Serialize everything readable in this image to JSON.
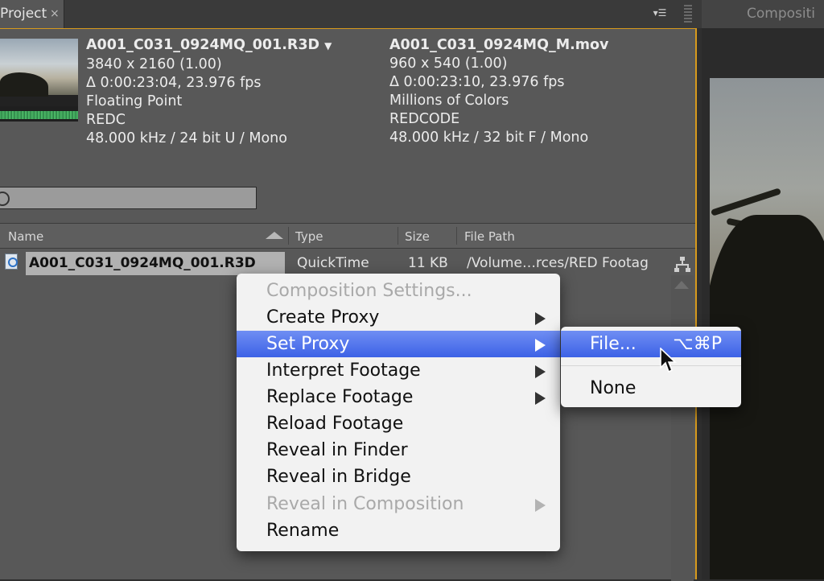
{
  "tabs": {
    "project": "Project",
    "close": "×",
    "composition": "Compositi"
  },
  "panel_menu_icon": "▾☰",
  "footage_info": {
    "source": {
      "name": "A001_C031_0924MQ_001.R3D",
      "caret": "▼",
      "resolution": "3840 x 2160 (1.00)",
      "duration": "Δ 0:00:23:04, 23.976 fps",
      "depth": "Floating Point",
      "codec": "REDC",
      "audio": "48.000 kHz / 24 bit U / Mono"
    },
    "proxy": {
      "name": "A001_C031_0924MQ_M.mov",
      "resolution": "960 x 540 (1.00)",
      "duration": "Δ 0:00:23:10, 23.976 fps",
      "depth": "Millions of Colors",
      "codec": "REDCODE",
      "audio": "48.000 kHz / 32 bit F / Mono"
    }
  },
  "search": {
    "placeholder": ""
  },
  "columns": {
    "name": "Name",
    "type": "Type",
    "size": "Size",
    "path": "File Path"
  },
  "items": [
    {
      "name": "A001_C031_0924MQ_001.R3D",
      "type": "QuickTime",
      "size": "11 KB",
      "path": "/Volume…rces/RED Footag"
    }
  ],
  "context_menu": {
    "items": [
      {
        "label": "Composition Settings...",
        "enabled": false,
        "submenu": false
      },
      {
        "label": "Create Proxy",
        "enabled": true,
        "submenu": true
      },
      {
        "label": "Set Proxy",
        "enabled": true,
        "submenu": true,
        "highlighted": true
      },
      {
        "label": "Interpret Footage",
        "enabled": true,
        "submenu": true
      },
      {
        "label": "Replace Footage",
        "enabled": true,
        "submenu": true
      },
      {
        "label": "Reload Footage",
        "enabled": true,
        "submenu": false
      },
      {
        "label": "Reveal in Finder",
        "enabled": true,
        "submenu": false
      },
      {
        "label": "Reveal in Bridge",
        "enabled": true,
        "submenu": false
      },
      {
        "label": "Reveal in Composition",
        "enabled": false,
        "submenu": true
      },
      {
        "label": "Rename",
        "enabled": true,
        "submenu": false
      }
    ]
  },
  "submenu": {
    "file": "File...",
    "file_shortcut": "⌥⌘P",
    "none": "None"
  },
  "colors": {
    "accent_border": "#d79a1c",
    "menu_highlight": "#3d62e6"
  }
}
